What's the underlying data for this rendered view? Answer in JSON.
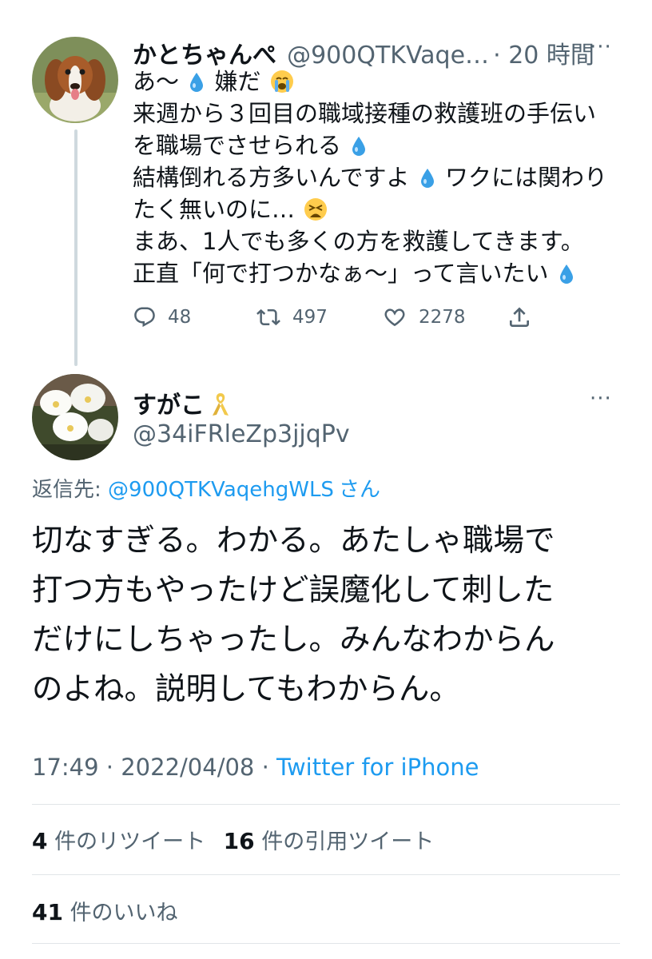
{
  "parent_tweet": {
    "display_name": "かとちゃんぺ",
    "handle": "@900QTKVaqe…",
    "time": "· 20 時間",
    "more_label": "···",
    "lines": [
      "あ〜",
      "嫌だ",
      "来週から３回目の職域接種の救護班の手伝い",
      "を職場でさせられる",
      "結構倒れる方多いんですよ",
      "ワクには関わり",
      "たく無いのに…",
      "まあ、1人でも多くの方を救護してきます。",
      "正直「何で打つかなぁ〜」って言いたい"
    ],
    "reply_count": "48",
    "retweet_count": "497",
    "like_count": "2278"
  },
  "reply_tweet": {
    "display_name": "すがこ",
    "handle": "@34iFRleZp3jjqPv",
    "more_label": "···",
    "reply_to_prefix": "返信先: ",
    "reply_to_handle": "@900QTKVaqehgWLS",
    "reply_to_suffix": "さん",
    "text_lines": [
      "切なすぎる。わかる。あたしゃ職場で",
      "打つ方もやったけど誤魔化して刺した",
      "だけにしちゃったし。みんなわからん",
      "のよね。説明してもわからん。"
    ],
    "timestamp": "17:49 · 2022/04/08 · ",
    "source": "Twitter for iPhone",
    "retweets_count": "4",
    "retweets_label": "件のリツイート",
    "quotes_count": "16",
    "quotes_label": "件の引用ツイート",
    "likes_count": "41",
    "likes_label": "件のいいね"
  },
  "colors": {
    "link": "#1d9bf0",
    "secondary_text": "#536471",
    "thread_line": "#cfd9de",
    "ribbon": "#f2c94c"
  },
  "icons": [
    "water-drop-icon",
    "crying-face-emoji",
    "weary-face-emoji",
    "reply-icon",
    "retweet-icon",
    "like-icon",
    "share-icon",
    "yellow-ribbon-emoji",
    "more-icon"
  ]
}
